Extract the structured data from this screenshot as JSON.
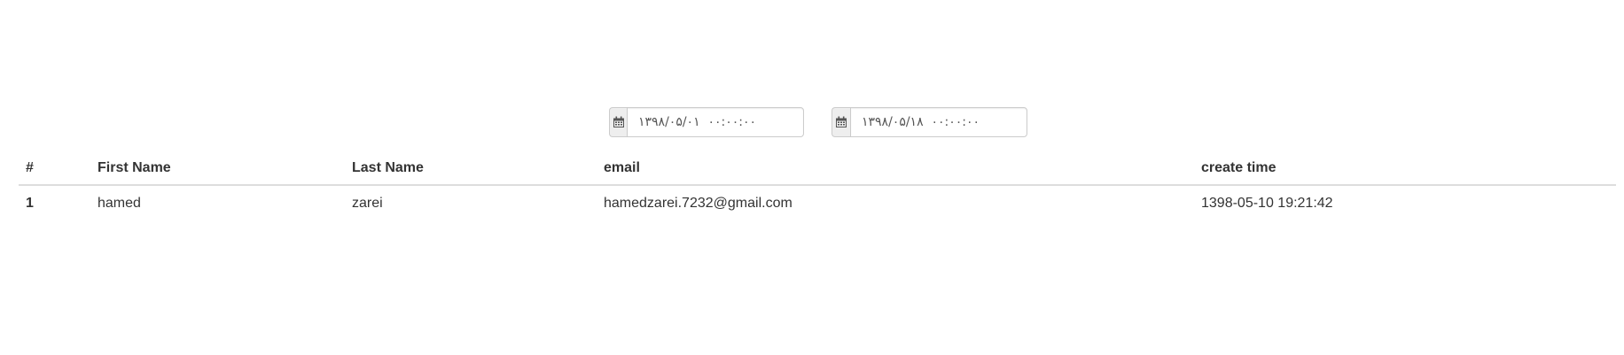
{
  "filters": {
    "from": {
      "icon": "calendar-icon",
      "value": "۱۳۹۸/۰۵/۰۱  ۰۰:۰۰:۰۰"
    },
    "to": {
      "icon": "calendar-icon",
      "value": "۱۳۹۸/۰۵/۱۸  ۰۰:۰۰:۰۰"
    }
  },
  "table": {
    "headers": [
      "#",
      "First Name",
      "Last Name",
      "email",
      "create time"
    ],
    "rows": [
      [
        "1",
        "hamed",
        "zarei",
        "hamedzarei.7232@gmail.com",
        "1398-05-10 19:21:42"
      ]
    ]
  },
  "colors": {
    "border": "#cccccc",
    "addon_bg": "#eeeeee",
    "text": "#333333",
    "header_rule": "#dddddd"
  }
}
